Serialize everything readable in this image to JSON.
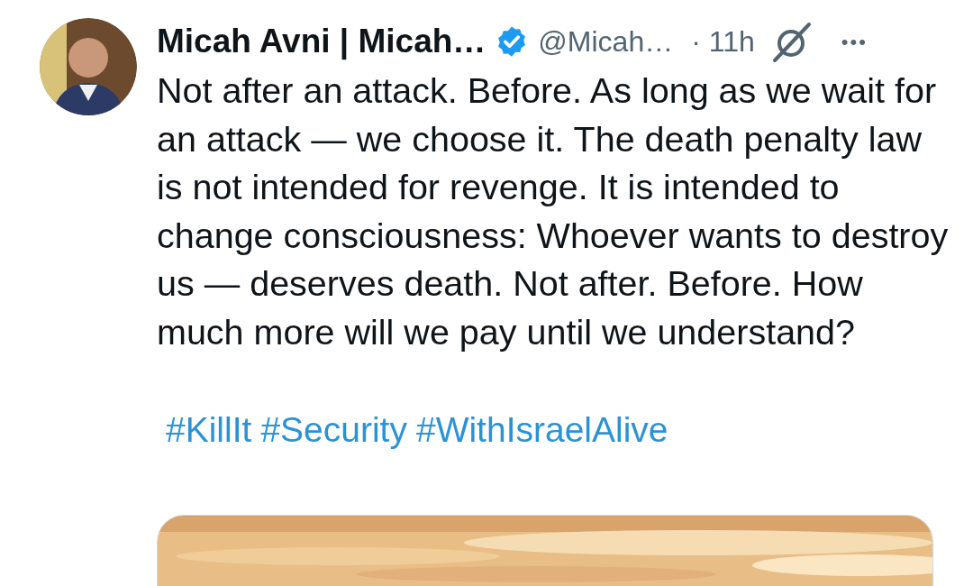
{
  "post": {
    "author_name": "Micah Avni | Micah…",
    "verified": true,
    "handle": "@Micah…",
    "time": "· 11h",
    "more": "•••",
    "text": "Not after an attack. Before. As long as we wait for an attack — we choose it. The death penalty law is not intended for revenge. It is intended to change consciousness: Whoever wants to destroy us — deserves death. Not after. Before. How much more will we pay until we understand?",
    "hashtags": [
      "#KillIt",
      "#Security",
      "#WithIsraelAlive"
    ]
  }
}
